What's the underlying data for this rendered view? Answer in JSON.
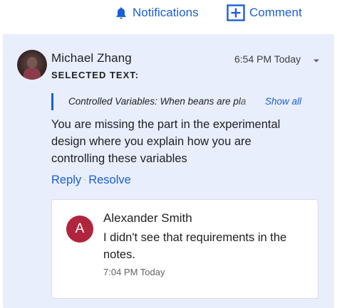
{
  "toolbar": {
    "notifications_label": "Notifications",
    "comment_label": "Comment",
    "icons": [
      "bell-icon",
      "add-comment-icon"
    ],
    "accent_color": "#1a5fd6"
  },
  "comment": {
    "author": "Michael Zhang",
    "timestamp": "6:54 PM Today",
    "selected_text_label": "SELECTED TEXT:",
    "quote": "Controlled Variables: When beans are pla",
    "show_all_label": "Show all",
    "body_lines": [
      "You are missing the part in the experimental",
      "design where you explain how you are",
      "controlling these variables"
    ],
    "reply_label": "Reply",
    "separator": "·",
    "resolve_label": "Resolve",
    "panel_color": "#e8eefb"
  },
  "reply": {
    "avatar_initial": "A",
    "avatar_color": "#b0253d",
    "author": "Alexander Smith",
    "text_lines": [
      "I didn't see that requirements in the",
      "notes."
    ],
    "timestamp": "7:04 PM Today"
  }
}
